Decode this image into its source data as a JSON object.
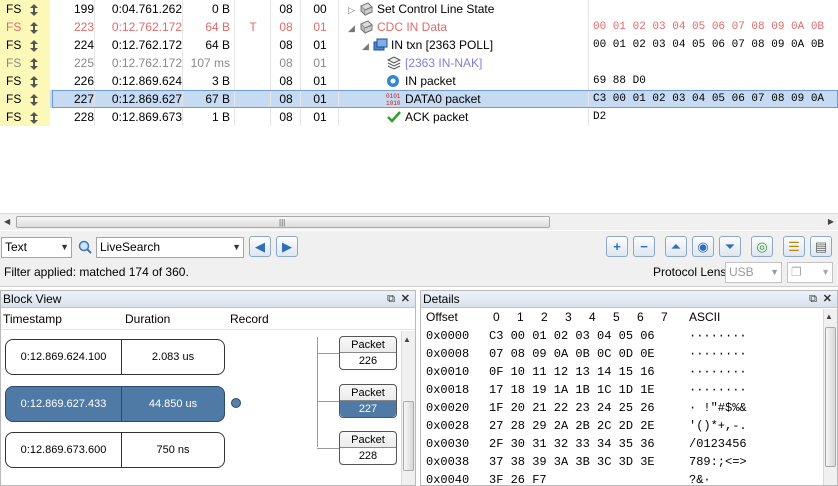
{
  "trace": {
    "rows": [
      {
        "fs": "FS",
        "index": "199",
        "time": "0:04.761.262",
        "len": "0 B",
        "err": "",
        "dev": "08",
        "ep": "00",
        "record": "Set Control Line State",
        "data": "",
        "style": "normal",
        "indent": 0,
        "tree": "▷",
        "icon": "gear-icon"
      },
      {
        "fs": "FS",
        "index": "223",
        "time": "0:12.762.172",
        "len": "64 B",
        "err": "T",
        "dev": "08",
        "ep": "01",
        "record": "CDC IN Data",
        "data": "00 01 02 03 04 05 06 07 08 09 0A 0B",
        "style": "red",
        "indent": 0,
        "tree": "◢",
        "icon": "gear-icon"
      },
      {
        "fs": "FS",
        "index": "224",
        "time": "0:12.762.172",
        "len": "64 B",
        "err": "",
        "dev": "08",
        "ep": "01",
        "record": "IN txn  [2363 POLL]",
        "data": "00 01 02 03 04 05 06 07 08 09 0A 0B",
        "style": "normal",
        "indent": 1,
        "tree": "◢",
        "icon": "transaction-icon"
      },
      {
        "fs": "FS",
        "index": "225",
        "time": "0:12.762.172",
        "len": "107 ms",
        "err": "",
        "dev": "08",
        "ep": "01",
        "record": "[2363 IN-NAK]",
        "data": "",
        "style": "gray",
        "indent": 2,
        "tree": "",
        "icon": "nak-stack-icon"
      },
      {
        "fs": "FS",
        "index": "226",
        "time": "0:12.869.624",
        "len": "3 B",
        "err": "",
        "dev": "08",
        "ep": "01",
        "record": "IN packet",
        "data": "69 88 D0",
        "style": "normal",
        "indent": 2,
        "tree": "",
        "icon": "in-token-icon"
      },
      {
        "fs": "FS",
        "index": "227",
        "time": "0:12.869.627",
        "len": "67 B",
        "err": "",
        "dev": "08",
        "ep": "01",
        "record": "DATA0 packet",
        "data": "C3 00 01 02 03 04 05 06 07 08 09 0A",
        "style": "selected",
        "indent": 2,
        "tree": "",
        "icon": "binary-data-icon"
      },
      {
        "fs": "FS",
        "index": "228",
        "time": "0:12.869.673",
        "len": "1 B",
        "err": "",
        "dev": "08",
        "ep": "01",
        "record": "ACK packet",
        "data": "D2",
        "style": "normal",
        "indent": 2,
        "tree": "",
        "icon": "check-icon"
      }
    ]
  },
  "toolbar": {
    "view_mode": "Text",
    "search_value": "LiveSearch",
    "prev_icon": "arrow-left-icon",
    "next_icon": "arrow-right-icon",
    "filter_status": "Filter applied: matched 174 of 360.",
    "protocol_lens_label": "Protocol Lens:",
    "protocol_lens_value": "USB"
  },
  "block_view": {
    "title": "Block View",
    "col_timestamp": "Timestamp",
    "col_duration": "Duration",
    "col_record": "Record",
    "blocks": [
      {
        "time": "0:12.869.624.100",
        "duration": "2.083 us"
      },
      {
        "time": "0:12.869.627.433",
        "duration": "44.850 us"
      },
      {
        "time": "0:12.869.673.600",
        "duration": "750 ns"
      }
    ],
    "packets": [
      {
        "label": "Packet",
        "num": "226"
      },
      {
        "label": "Packet",
        "num": "227"
      },
      {
        "label": "Packet",
        "num": "228"
      }
    ]
  },
  "details": {
    "title": "Details",
    "col_offset": "Offset",
    "col_bytes": [
      "0",
      "1",
      "2",
      "3",
      "4",
      "5",
      "6",
      "7"
    ],
    "col_ascii": "ASCII",
    "rows": [
      {
        "offset": "0x0000",
        "hex": "C3 00 01 02 03 04 05 06",
        "ascii": "········"
      },
      {
        "offset": "0x0008",
        "hex": "07 08 09 0A 0B 0C 0D 0E",
        "ascii": "········"
      },
      {
        "offset": "0x0010",
        "hex": "0F 10 11 12 13 14 15 16",
        "ascii": "········"
      },
      {
        "offset": "0x0018",
        "hex": "17 18 19 1A 1B 1C 1D 1E",
        "ascii": "········"
      },
      {
        "offset": "0x0020",
        "hex": "1F 20 21 22 23 24 25 26",
        "ascii": "· !\"#$%&"
      },
      {
        "offset": "0x0028",
        "hex": "27 28 29 2A 2B 2C 2D 2E",
        "ascii": "'()*+,-."
      },
      {
        "offset": "0x0030",
        "hex": "2F 30 31 32 33 34 35 36",
        "ascii": "/0123456"
      },
      {
        "offset": "0x0038",
        "hex": "37 38 39 3A 3B 3C 3D 3E",
        "ascii": "789:;<=>"
      },
      {
        "offset": "0x0040",
        "hex": "3F 26 F7",
        "ascii": "?&·"
      }
    ]
  }
}
